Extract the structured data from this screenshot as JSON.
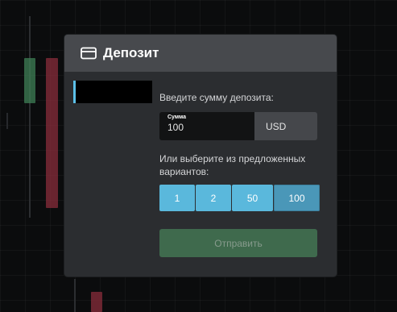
{
  "modal": {
    "title": "Депозит",
    "icon": "credit-card-icon"
  },
  "form": {
    "amount_label": "Введите сумму депозита:",
    "amount_caption": "Сумма",
    "amount_value": "100",
    "currency": "USD",
    "choose_label": "Или выберите из предложенных вариантов:",
    "presets": [
      "1",
      "2",
      "50",
      "100"
    ],
    "selected_preset": "100",
    "submit_label": "Отправить"
  },
  "colors": {
    "header_bg": "#47494d",
    "modal_bg": "#2b2d30",
    "accent": "#5ab8dc",
    "submit_bg": "#3f6a4d"
  }
}
